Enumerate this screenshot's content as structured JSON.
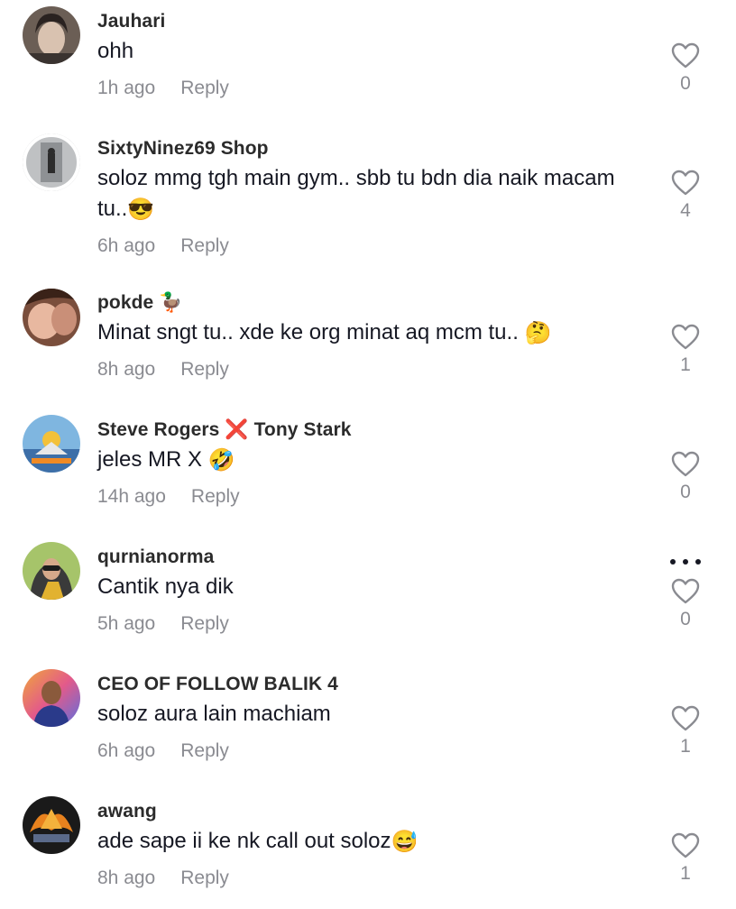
{
  "comments": [
    {
      "username": "Jauhari",
      "text": "ohh",
      "time": "1h ago",
      "reply": "Reply",
      "likes": "0",
      "avatar_icon": "avatar-photo"
    },
    {
      "username": "SixtyNinez69 Shop",
      "text": "soloz mmg tgh main gym.. sbb tu bdn dia naik macam tu..",
      "emoji": "😎",
      "time": "6h ago",
      "reply": "Reply",
      "likes": "4",
      "avatar_icon": "avatar-photo"
    },
    {
      "username": "pokde",
      "username_emoji": "🦆",
      "text": "Minat sngt tu.. xde ke org minat aq mcm tu..",
      "emoji": "🤔",
      "time": "8h ago",
      "reply": "Reply",
      "likes": "1",
      "avatar_icon": "avatar-photo"
    },
    {
      "username": "Steve Rogers",
      "username_emoji": "❌",
      "username_suffix": "Tony Stark",
      "text": "jeles MR X",
      "emoji": "🤣",
      "time": "14h ago",
      "reply": "Reply",
      "likes": "0",
      "avatar_icon": "avatar-photo"
    },
    {
      "username": "qurnianorma",
      "text": "Cantik nya dik",
      "time": "5h ago",
      "reply": "Reply",
      "likes": "0",
      "avatar_icon": "avatar-photo",
      "more_icon": "more-dots-icon"
    },
    {
      "username": "CEO OF FOLLOW BALIK 4",
      "text": "soloz aura lain machiam",
      "time": "6h ago",
      "reply": "Reply",
      "likes": "1",
      "avatar_icon": "avatar-photo"
    },
    {
      "username": "awang",
      "text": "ade sape ii ke nk call out soloz",
      "emoji": "😅",
      "time": "8h ago",
      "reply": "Reply",
      "likes": "1",
      "avatar_icon": "avatar-photo"
    }
  ],
  "colors": {
    "text": "#161823",
    "muted": "#8a8b91",
    "username": "#2b2b2b"
  }
}
